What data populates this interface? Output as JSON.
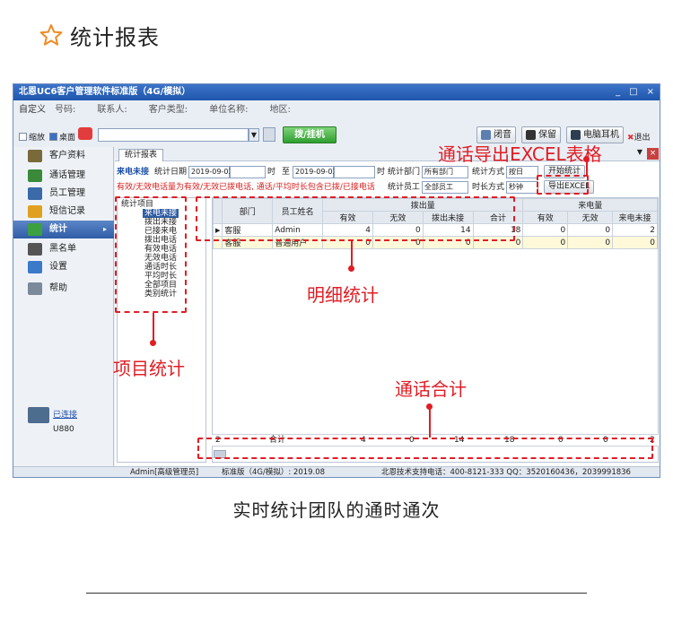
{
  "heading": "统计报表",
  "caption": "实时统计团队的通时通次",
  "window": {
    "title": "北恩UC6客户管理软件标准版（4G/模拟）",
    "controls": [
      "_",
      "□",
      "×"
    ]
  },
  "infobar": {
    "custom": "自定义",
    "fields": [
      "号码:",
      "联系人:",
      "客户类型:",
      "单位名称:",
      "地区:"
    ]
  },
  "toolbar": {
    "zoom_label": "缩放",
    "desktop_label": "桌面",
    "dial_value": "",
    "dd_glyph": "▼",
    "hang_label": "拨/挂机",
    "mute_label": "闭音",
    "hold_label": "保留",
    "pc_headset_label": "电脑耳机",
    "exit_label": "退出",
    "exit_glyph": "✖"
  },
  "sidebar": {
    "items": [
      {
        "label": "客户资料",
        "color": "#7a6a3a"
      },
      {
        "label": "通话管理",
        "color": "#3a8a3a"
      },
      {
        "label": "员工管理",
        "color": "#3a6aa8"
      },
      {
        "label": "短信记录",
        "color": "#e0a020"
      },
      {
        "label": "统计",
        "color": "#3aa040"
      },
      {
        "label": "黑名单",
        "color": "#555555"
      },
      {
        "label": "设置",
        "color": "#3a7ac8"
      },
      {
        "label": "帮助",
        "color": "#7a8a9a"
      }
    ],
    "active_arrow": "▸",
    "connection_status": "已连接",
    "device_model": "U880"
  },
  "content": {
    "tab_label": "统计报表",
    "tab_close": "×",
    "tab_dd": "▼",
    "filter": {
      "title": "来电未接",
      "date_label": "统计日期",
      "date_from": "2019-09-03",
      "hour_label": "时",
      "to_label": "至",
      "date_to": "2019-09-03",
      "hour_label2": "时",
      "dept_label": "统计部门",
      "dept_value": "所有部门",
      "method_label": "统计方式",
      "method_value": "按日",
      "start_button": "开始统计",
      "note": "有效/无效电话量为有效/无效已拨电话, 通话/平均时长包含已拨/已接电话",
      "staff_label": "统计员工",
      "staff_value": "全部员工",
      "duration_label": "时长方式",
      "duration_value": "秒钟",
      "export_button": "导出EXCEL"
    },
    "tree": {
      "root": "统计项目",
      "items": [
        "来电未接",
        "拨出未接",
        "已接来电",
        "拨出电话",
        "有效电话",
        "无效电话",
        "通话时长",
        "平均时长",
        "全部项目",
        "类别统计"
      ],
      "selected": 0
    },
    "grid": {
      "headers_top": [
        "部门",
        "员工姓名",
        "拨出量",
        "来电量"
      ],
      "headers_sub": [
        "有效",
        "无效",
        "拨出未接",
        "合计",
        "有效",
        "无效",
        "来电未接"
      ],
      "indicator": "▶",
      "rows": [
        [
          "客服",
          "Admin",
          "4",
          "0",
          "14",
          "18",
          "0",
          "0",
          "2"
        ],
        [
          "客服",
          "普通用户",
          "0",
          "0",
          "0",
          "0",
          "0",
          "0",
          "0"
        ]
      ],
      "totals": [
        "2",
        "合计",
        "4",
        "0",
        "14",
        "18",
        "0",
        "0",
        "2"
      ]
    }
  },
  "statusbar": {
    "user": "Admin[高级管理员]",
    "version": "标准版（4G/模拟）: 2019.08",
    "support": "北恩技术支持电话：400-8121-333  QQ：3520160436，2039991836"
  },
  "annotations": {
    "export": "通话导出EXCEL表格",
    "detail": "明细统计",
    "items": "项目统计",
    "totals": "通话合计"
  },
  "colors": {
    "accent_red": "#e11d24",
    "titlebar_blue": "#1f56ad",
    "star_orange": "#f08a24"
  }
}
